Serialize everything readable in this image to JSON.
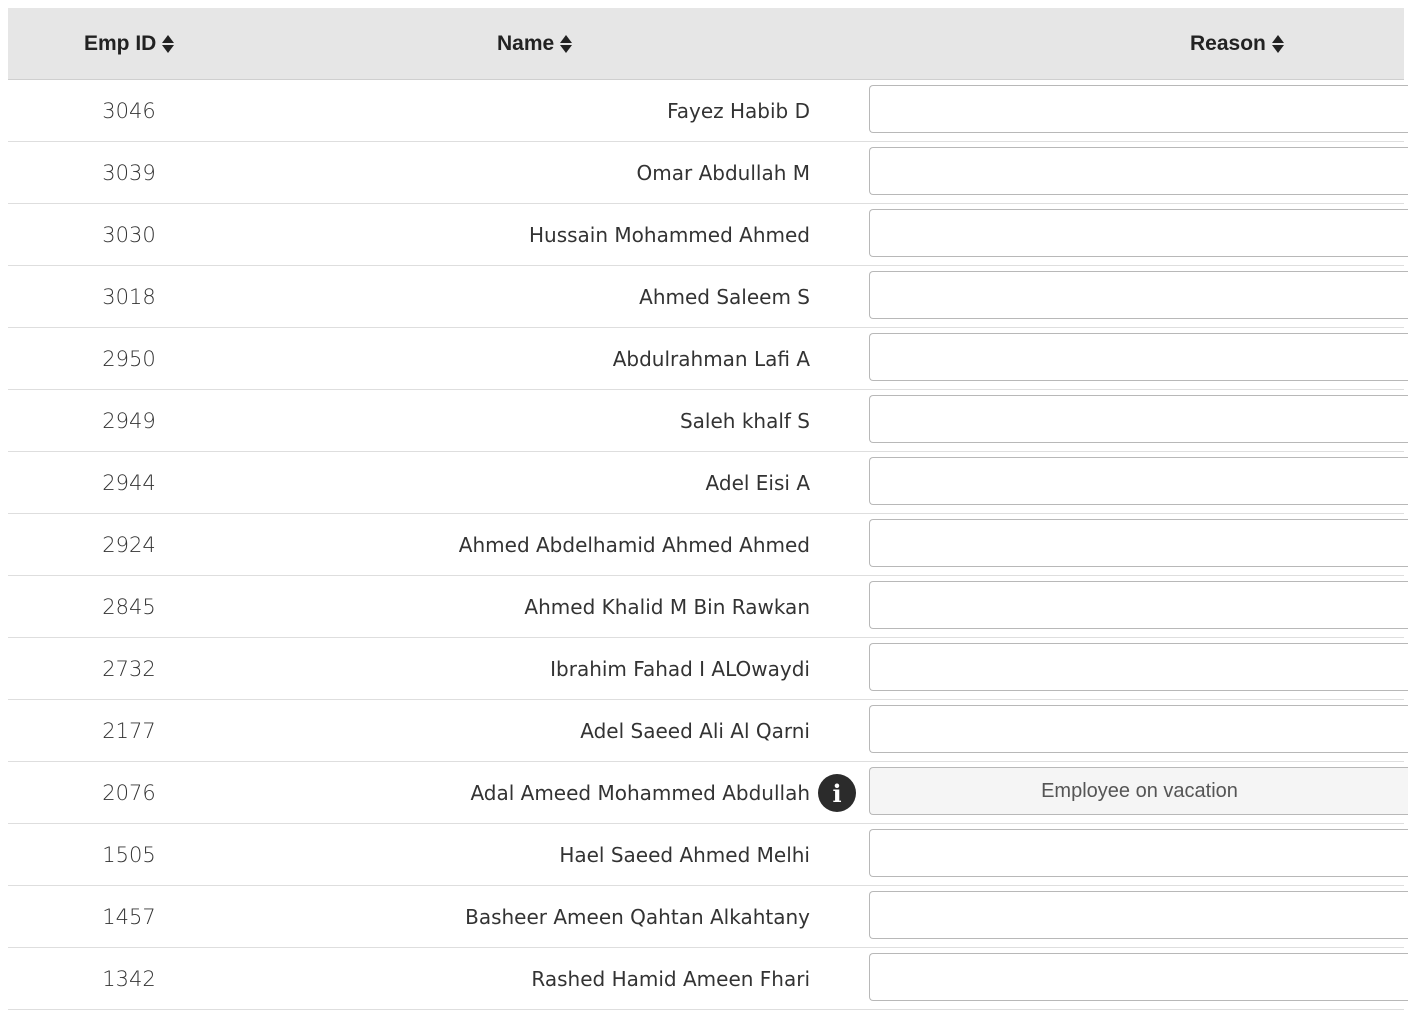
{
  "table": {
    "headers": {
      "emp_id": "Emp ID",
      "name": "Name",
      "reason": "Reason"
    },
    "rows": [
      {
        "emp_id": "3046",
        "name": "Fayez Habib D",
        "reason": ""
      },
      {
        "emp_id": "3039",
        "name": "Omar Abdullah M",
        "reason": ""
      },
      {
        "emp_id": "3030",
        "name": "Hussain Mohammed Ahmed",
        "reason": ""
      },
      {
        "emp_id": "3018",
        "name": "Ahmed Saleem S",
        "reason": ""
      },
      {
        "emp_id": "2950",
        "name": "Abdulrahman Lafi A",
        "reason": ""
      },
      {
        "emp_id": "2949",
        "name": "Saleh khalf S",
        "reason": ""
      },
      {
        "emp_id": "2944",
        "name": "Adel Eisi A",
        "reason": ""
      },
      {
        "emp_id": "2924",
        "name": "Ahmed Abdelhamid Ahmed Ahmed",
        "reason": ""
      },
      {
        "emp_id": "2845",
        "name": "Ahmed Khalid M Bin Rawkan",
        "reason": ""
      },
      {
        "emp_id": "2732",
        "name": "Ibrahim Fahad I ALOwaydi",
        "reason": ""
      },
      {
        "emp_id": "2177",
        "name": "Adel Saeed Ali Al Qarni",
        "reason": ""
      },
      {
        "emp_id": "2076",
        "name": "Adal Ameed Mohammed Abdullah",
        "reason": "Employee on vacation",
        "info_icon": "info-icon"
      },
      {
        "emp_id": "1505",
        "name": "Hael Saeed Ahmed Melhi",
        "reason": ""
      },
      {
        "emp_id": "1457",
        "name": "Basheer Ameen Qahtan Alkahtany",
        "reason": ""
      },
      {
        "emp_id": "1342",
        "name": "Rashed Hamid Ameen Fhari",
        "reason": ""
      }
    ]
  },
  "icons": {
    "sort": "sort-icon",
    "info": "info-icon"
  }
}
